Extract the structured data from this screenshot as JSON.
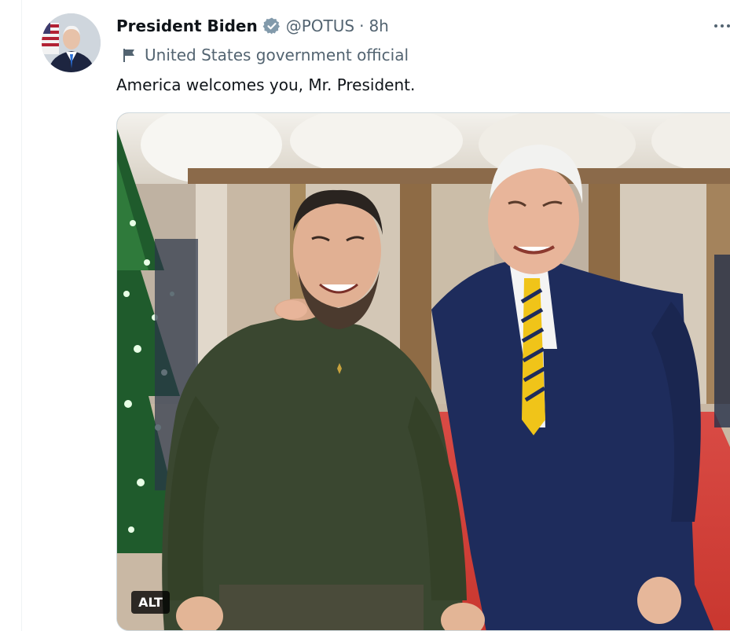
{
  "tweet": {
    "author": {
      "display_name": "President Biden",
      "verified_icon": "verified-badge-icon",
      "handle": "@POTUS",
      "separator": "·",
      "time": "8h",
      "avatar_icon": "avatar-portrait"
    },
    "label": {
      "icon": "flag-icon",
      "text": "United States government official"
    },
    "text": "America welcomes you, Mr. President.",
    "media": {
      "type": "photo",
      "alt_label": "ALT"
    },
    "more_icon": "more-options-icon"
  },
  "colors": {
    "primary_text": "#0f1419",
    "secondary_text": "#536471",
    "badge_gray": "#829aab",
    "border": "#cfd9de"
  }
}
